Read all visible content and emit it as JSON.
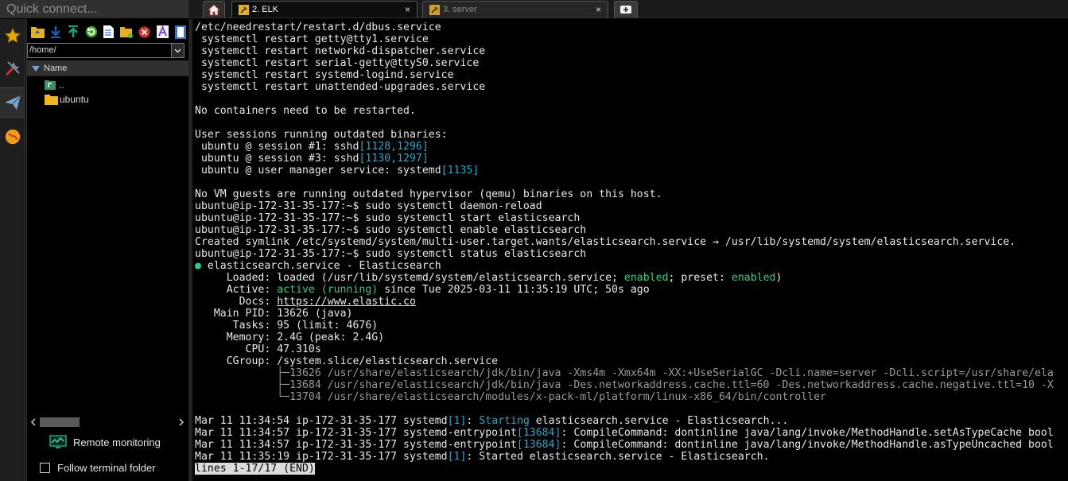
{
  "quick_connect": {
    "placeholder": "Quick connect..."
  },
  "side_rail": [
    {
      "icon": "star-icon",
      "color": "#e6a800"
    },
    {
      "icon": "tools-icon",
      "color": "#c0392b"
    },
    {
      "icon": "paper-plane-icon",
      "color": "#7fa6c9"
    },
    {
      "icon": "globe-icon",
      "color": "#f39c12"
    }
  ],
  "sftp": {
    "toolbar": [
      "folder-up-icon",
      "download-icon",
      "upload-icon",
      "refresh-icon",
      "new-file-icon",
      "new-folder-icon",
      "delete-icon",
      "rename-icon",
      "bookmark-icon"
    ],
    "path": "/home/",
    "column_header": "Name",
    "files": [
      {
        "name": "..",
        "icon": "parent-folder-icon"
      },
      {
        "name": "ubuntu",
        "icon": "folder-icon"
      }
    ],
    "remote_monitoring": "Remote monitoring",
    "follow_terminal_folder": "Follow terminal folder"
  },
  "tabs": [
    {
      "label": "",
      "icon": "home-icon"
    },
    {
      "label": "2. ELK",
      "icon": "tool-icon",
      "active": true,
      "close": "×"
    },
    {
      "label": "3. server",
      "icon": "tool-icon",
      "active": false,
      "close": "×"
    },
    {
      "label": "",
      "icon": "plus-icon"
    }
  ],
  "terminal": {
    "colors": {
      "green": "#23d18b",
      "blue": "#2aa7c9",
      "fg": "#e8e8e8"
    },
    "lines": [
      [
        [
          "/etc/needrestart/restart.d/dbus.service",
          ""
        ]
      ],
      [
        [
          " systemctl restart getty@tty1.service",
          ""
        ]
      ],
      [
        [
          " systemctl restart networkd-dispatcher.service",
          ""
        ]
      ],
      [
        [
          " systemctl restart serial-getty@ttyS0.service",
          ""
        ]
      ],
      [
        [
          " systemctl restart systemd-logind.service",
          ""
        ]
      ],
      [
        [
          " systemctl restart unattended-upgrades.service",
          ""
        ]
      ],
      [],
      [
        [
          "No containers need to be restarted.",
          ""
        ]
      ],
      [],
      [
        [
          "User sessions running outdated binaries:",
          ""
        ]
      ],
      [
        [
          " ubuntu @ session #1: sshd",
          ""
        ],
        [
          "[1128,1296]",
          "blue"
        ]
      ],
      [
        [
          " ubuntu @ session #3: sshd",
          ""
        ],
        [
          "[1130,1297]",
          "blue"
        ]
      ],
      [
        [
          " ubuntu @ user manager service: systemd",
          ""
        ],
        [
          "[1135]",
          "blue"
        ]
      ],
      [],
      [
        [
          "No VM guests are running outdated hypervisor (qemu) binaries on this host.",
          ""
        ]
      ],
      [
        [
          "ubuntu@ip-172-31-35-177:~$ sudo systemctl daemon-reload",
          ""
        ]
      ],
      [
        [
          "ubuntu@ip-172-31-35-177:~$ sudo systemctl start elasticsearch",
          ""
        ]
      ],
      [
        [
          "ubuntu@ip-172-31-35-177:~$ sudo systemctl enable elasticsearch",
          ""
        ]
      ],
      [
        [
          "Created symlink /etc/systemd/system/multi-user.target.wants/elasticsearch.service → /usr/lib/systemd/system/elasticsearch.service.",
          ""
        ]
      ],
      [
        [
          "ubuntu@ip-172-31-35-177:~$ sudo systemctl status elasticsearch",
          ""
        ]
      ],
      [
        [
          "●",
          "dot"
        ],
        [
          " elasticsearch.service - Elasticsearch",
          ""
        ]
      ],
      [
        [
          "     Loaded: loaded (/usr/lib/systemd/system/elasticsearch.service; ",
          ""
        ],
        [
          "enabled",
          "green"
        ],
        [
          "; preset: ",
          ""
        ],
        [
          "enabled",
          "green"
        ],
        [
          ")",
          ""
        ]
      ],
      [
        [
          "     Active: ",
          ""
        ],
        [
          "active (running)",
          "green"
        ],
        [
          " since Tue 2025-03-11 11:35:19 UTC; 50s ago",
          ""
        ]
      ],
      [
        [
          "       Docs: ",
          ""
        ],
        [
          "https://www.elastic.co",
          "link"
        ]
      ],
      [
        [
          "   Main PID: 13626 (java)",
          ""
        ]
      ],
      [
        [
          "      Tasks: 95 (limit: 4676)",
          ""
        ]
      ],
      [
        [
          "     Memory: 2.4G (peak: 2.4G)",
          ""
        ]
      ],
      [
        [
          "        CPU: 47.310s",
          ""
        ]
      ],
      [
        [
          "     CGroup: /system.slice/elasticsearch.service",
          ""
        ]
      ],
      [
        [
          "             ├─13626 /usr/share/elasticsearch/jdk/bin/java -Xms4m -Xmx64m -XX:+UseSerialGC -Dcli.name=server -Dcli.script=/usr/share/ela",
          "grey"
        ]
      ],
      [
        [
          "             ├─13684 /usr/share/elasticsearch/jdk/bin/java -Des.networkaddress.cache.ttl=60 -Des.networkaddress.cache.negative.ttl=10 -X",
          "grey"
        ]
      ],
      [
        [
          "             └─13704 /usr/share/elasticsearch/modules/x-pack-ml/platform/linux-x86_64/bin/controller",
          "grey"
        ]
      ],
      [],
      [
        [
          "Mar 11 11:34:54 ip-172-31-35-177 systemd",
          ""
        ],
        [
          "[1]",
          "blue"
        ],
        [
          ": ",
          ""
        ],
        [
          "Starting",
          "blue"
        ],
        [
          " elasticsearch.service - Elasticsearch...",
          ""
        ]
      ],
      [
        [
          "Mar 11 11:34:57 ip-172-31-35-177 systemd-entrypoint",
          ""
        ],
        [
          "[13684]",
          "blue"
        ],
        [
          ": CompileCommand: dontinline java/lang/invoke/MethodHandle.setAsTypeCache bool",
          ""
        ]
      ],
      [
        [
          "Mar 11 11:34:57 ip-172-31-35-177 systemd-entrypoint",
          ""
        ],
        [
          "[13684]",
          "blue"
        ],
        [
          ": CompileCommand: dontinline java/lang/invoke/MethodHandle.asTypeUncached bool",
          ""
        ]
      ],
      [
        [
          "Mar 11 11:35:19 ip-172-31-35-177 systemd",
          ""
        ],
        [
          "[1]",
          "blue"
        ],
        [
          ": Started elasticsearch.service - Elasticsearch.",
          ""
        ]
      ],
      [
        [
          "lines 1-17/17 (END)",
          "hl"
        ]
      ]
    ]
  }
}
